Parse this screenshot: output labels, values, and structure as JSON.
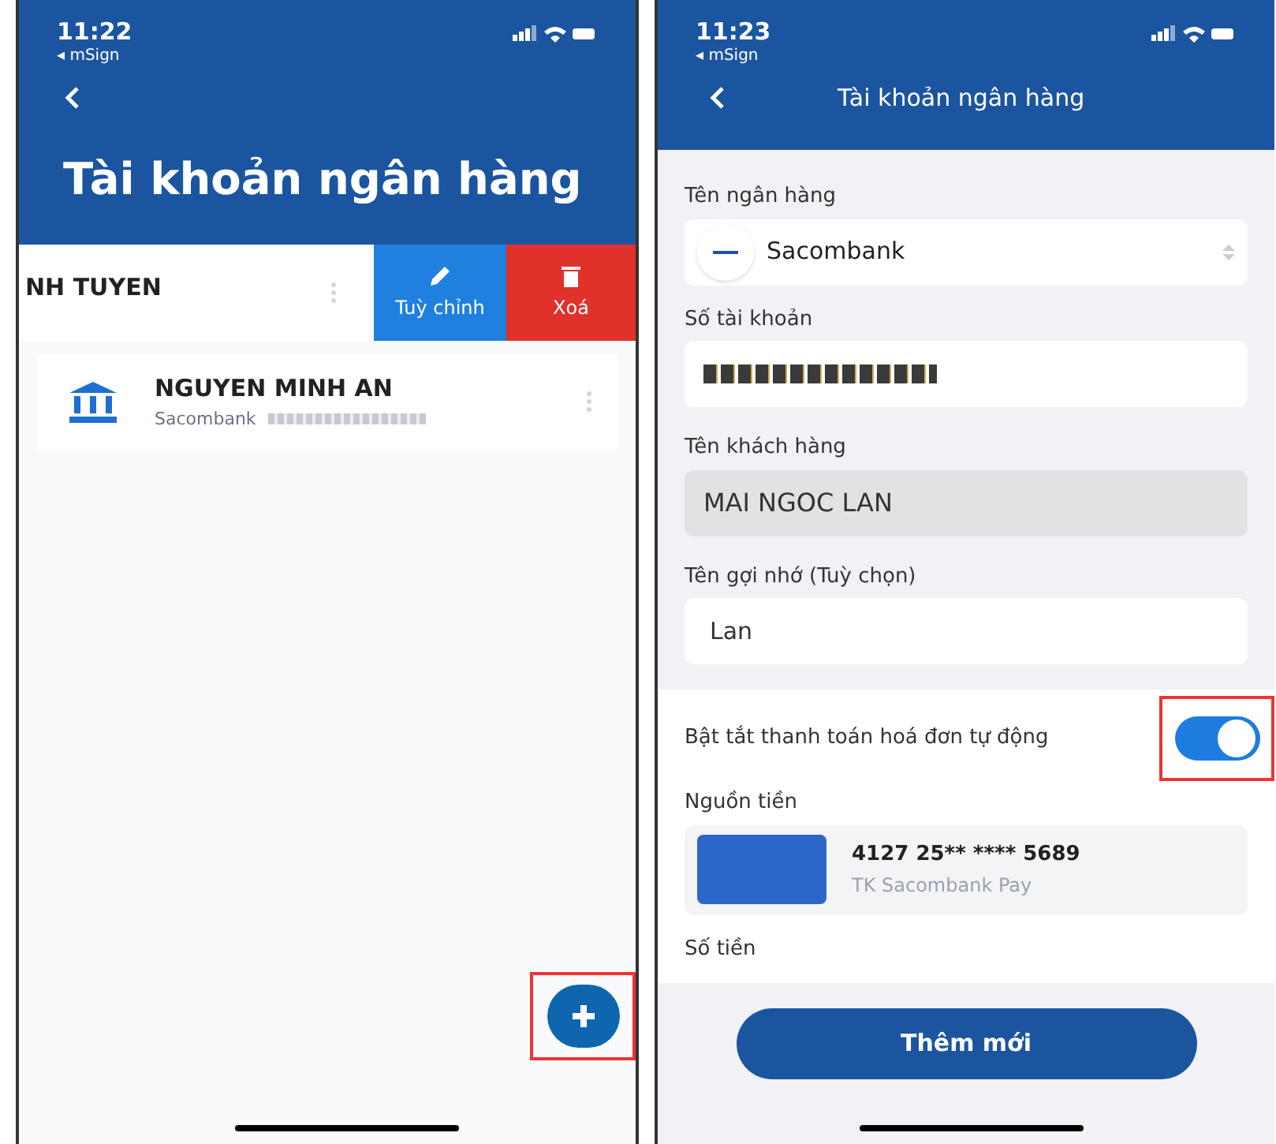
{
  "screens": [
    {
      "kind": "list",
      "status_bar": {
        "time": "11:22",
        "back_app": "◂ mSign"
      },
      "title": "Tài khoản ngân hàng",
      "accounts": [
        {
          "name": "NH TUYEN",
          "swiped": true,
          "actions": [
            {
              "kind": "edit",
              "label": "Tuỳ chỉnh"
            },
            {
              "kind": "delete",
              "label": "Xoá"
            }
          ]
        },
        {
          "name": "NGUYEN MINH AN",
          "bank": "Sacombank",
          "swiped": false
        }
      ],
      "fab": {
        "highlighted": true
      }
    },
    {
      "kind": "form",
      "status_bar": {
        "time": "11:23",
        "back_app": "◂ mSign"
      },
      "title": "Tài khoản ngân hàng",
      "fields": [
        {
          "kind": "select",
          "label": "Tên ngân hàng",
          "value": "Sacombank"
        },
        {
          "kind": "redacted",
          "label": "Số tài khoản"
        },
        {
          "kind": "readonly",
          "label": "Tên khách hàng",
          "value": "MAI NGOC LAN"
        },
        {
          "kind": "text",
          "label": "Tên gợi nhớ (Tuỳ chọn)",
          "value": "Lan"
        }
      ],
      "autopay": {
        "label": "Bật tắt thanh toán hoá đơn tự động",
        "on": true,
        "highlighted": true
      },
      "source": {
        "label": "Nguồn tiền",
        "card_number": "4127 25** **** 5689",
        "account": "TK Sacombank Pay"
      },
      "amount_label": "Số tiền",
      "submit": "Thêm mới"
    }
  ]
}
